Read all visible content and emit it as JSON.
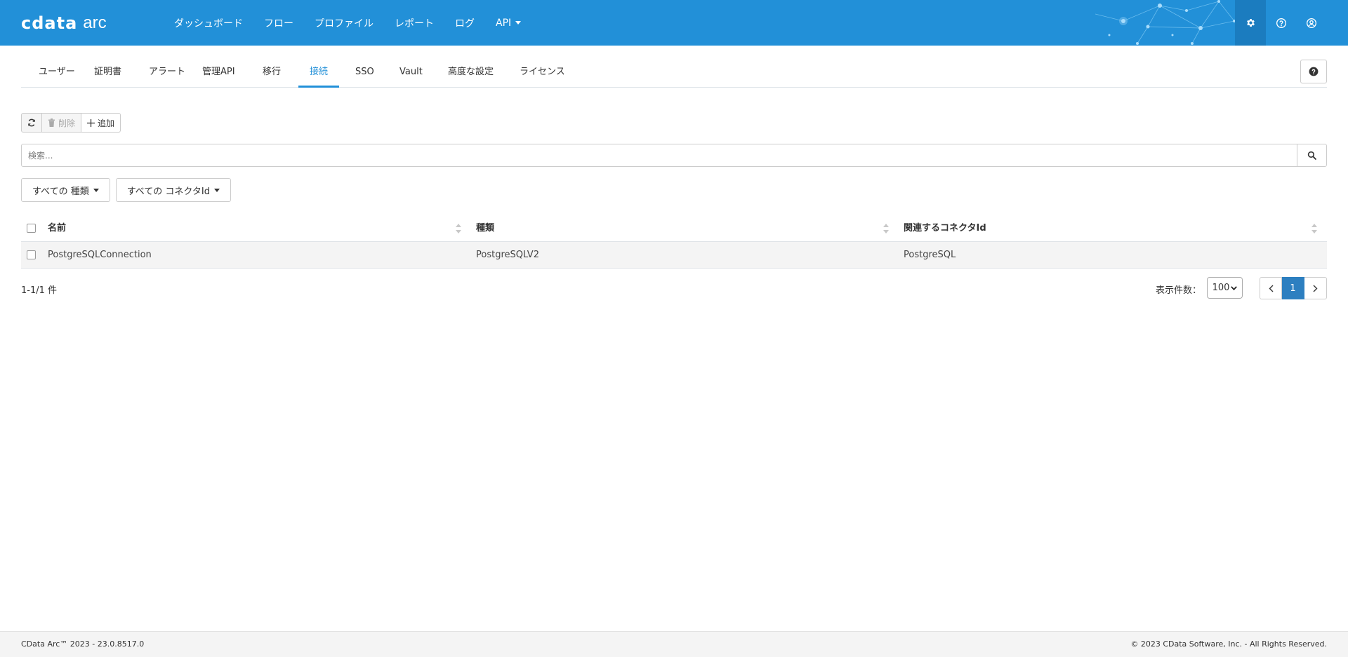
{
  "app": {
    "logo_cdata": "cdata",
    "logo_arc": "arc"
  },
  "topnav": {
    "items": [
      "ダッシュボード",
      "フロー",
      "プロファイル",
      "レポート",
      "ログ",
      "API"
    ],
    "icons": [
      "gear-icon",
      "question-circle-icon",
      "user-circle-icon"
    ]
  },
  "subnav": {
    "tabs": [
      "ユーザー",
      "証明書",
      "アラート",
      "管理API",
      "移行",
      "接続",
      "SSO",
      "Vault",
      "高度な設定",
      "ライセンス"
    ],
    "active_tab": "接続"
  },
  "toolbar": {
    "delete_label": "削除",
    "add_label": "追加"
  },
  "search": {
    "placeholder": "検索..."
  },
  "filters": {
    "type_label": "すべての 種類",
    "connector_label": "すべての コネクタId"
  },
  "table": {
    "headers": [
      "名前",
      "種類",
      "関連するコネクタId"
    ],
    "rows": [
      [
        "PostgreSQLConnection",
        "PostgreSQLV2",
        "PostgreSQL"
      ]
    ]
  },
  "summary": {
    "count_text": "1-1/1 件",
    "page_size_label": "表示件数：",
    "page_size": "100",
    "current_page": "1"
  },
  "footer": {
    "left": "CData Arc™ 2023 - 23.0.8517.0",
    "right": "© 2023 CData Software, Inc. - All Rights Reserved."
  },
  "colors": {
    "header_bg": "#2290d8",
    "header_active_icon_bg": "#1b7cbf",
    "active_tab": "#2290d8",
    "pager_active": "#2d7fc0"
  }
}
